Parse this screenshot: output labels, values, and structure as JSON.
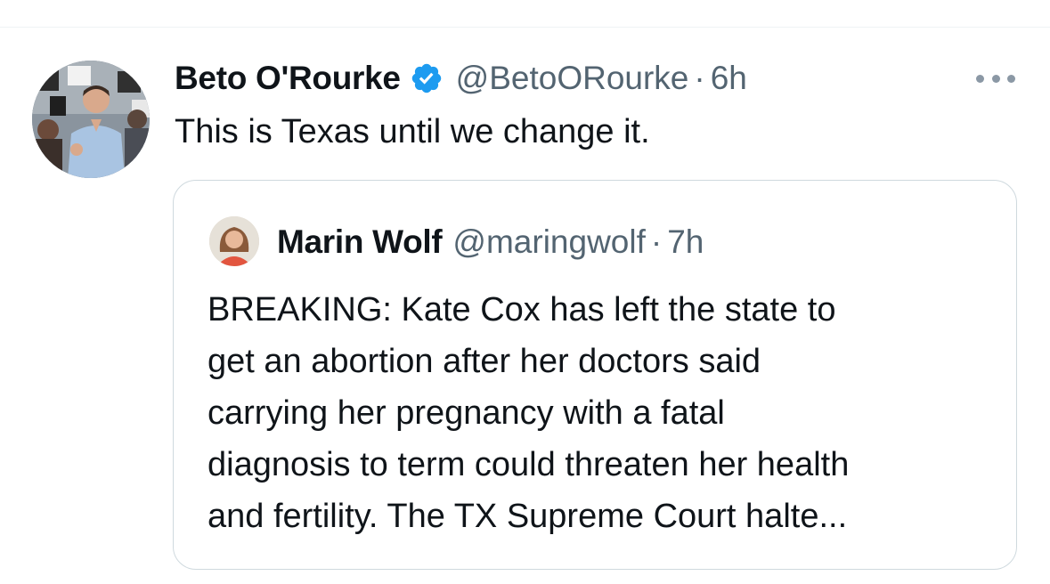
{
  "tweet": {
    "author_name": "Beto O'Rourke",
    "author_handle": "@BetoORourke",
    "separator": "·",
    "timestamp": "6h",
    "verified_icon": "verified-badge-icon",
    "text": "This is Texas until we change it."
  },
  "quoted_tweet": {
    "author_name": "Marin Wolf",
    "author_handle": "@maringwolf",
    "separator": "·",
    "timestamp": "7h",
    "text_lines": [
      "BREAKING: Kate Cox has left the state to",
      "get an abortion after her doctors said",
      "carrying her pregnancy with a fatal",
      "diagnosis to term could threaten her health",
      "and fertility. The TX Supreme Court halte..."
    ]
  },
  "icons": {
    "more": "more-options-icon"
  },
  "colors": {
    "text": "#0f1419",
    "muted": "#536471",
    "verified": "#1d9bf0",
    "border": "#cfd9de"
  }
}
